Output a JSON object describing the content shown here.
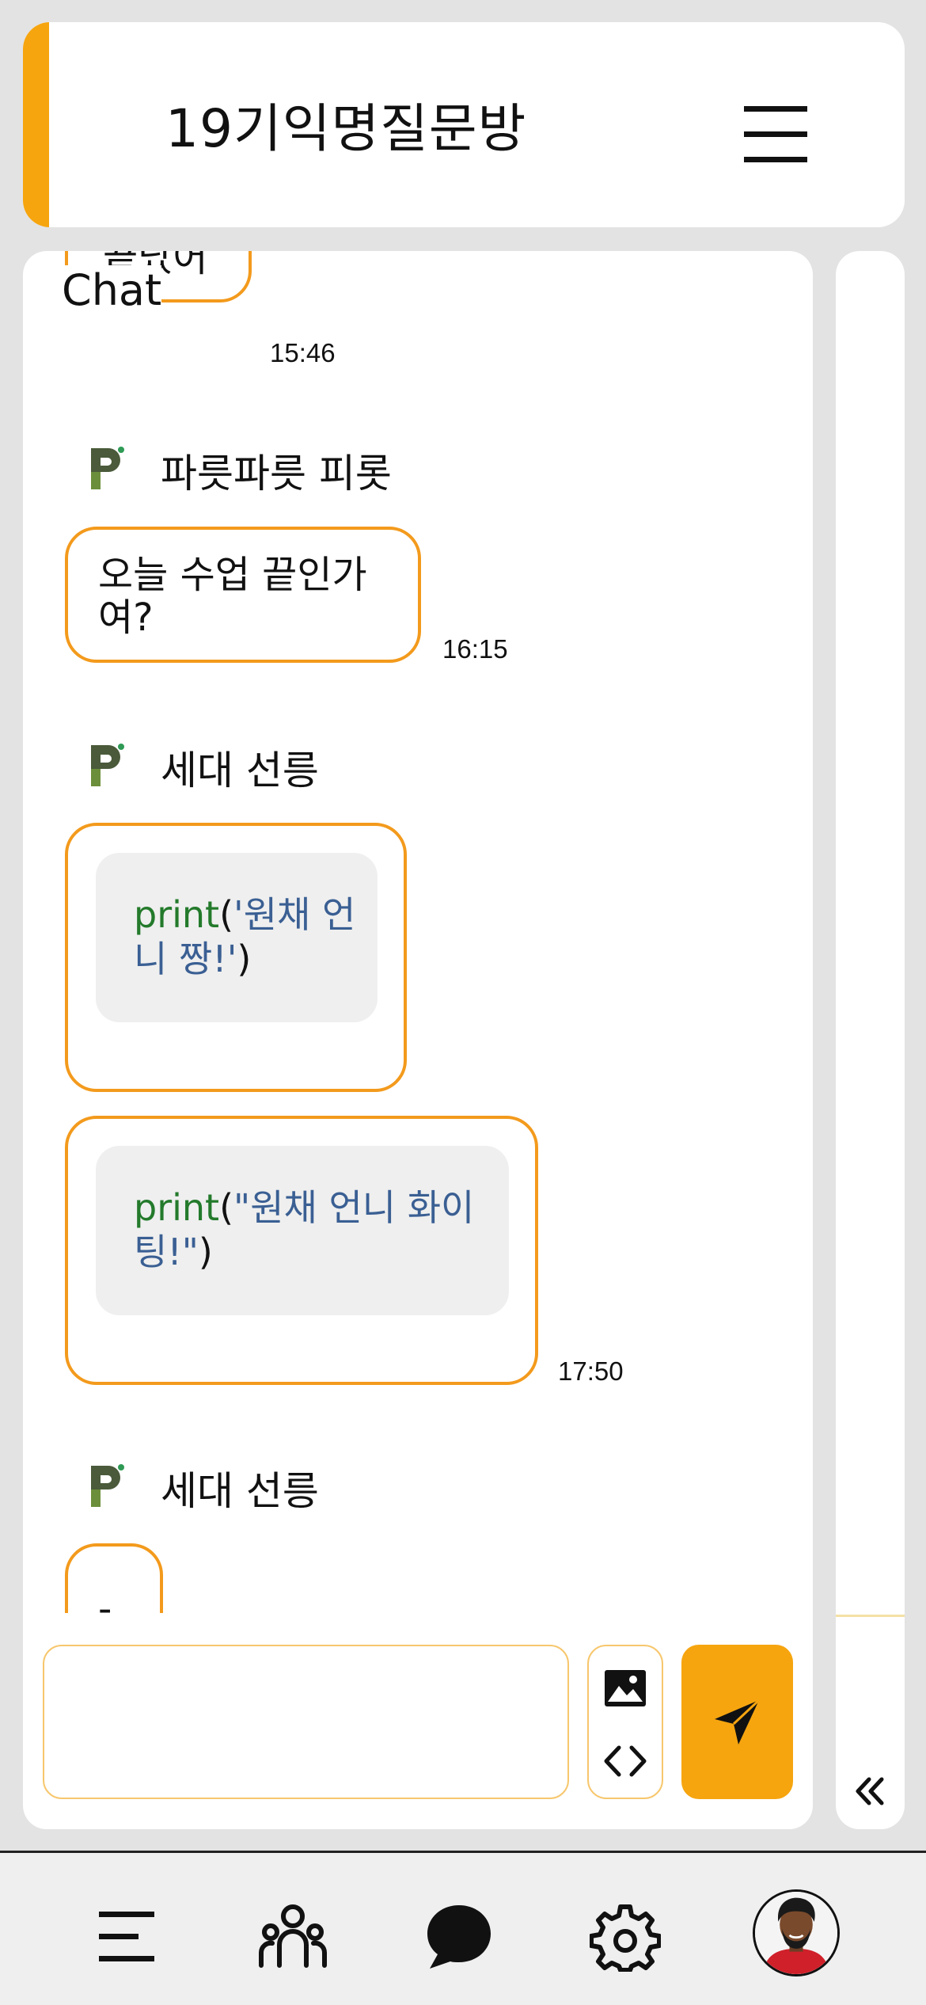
{
  "header": {
    "title": "19기익명질문방",
    "accent_color": "#f6a50f",
    "menu_icon": "hamburger-icon"
  },
  "chat": {
    "label": "Chat",
    "partial_top_bubble": {
      "text": "끝났어요?",
      "time": "15:46"
    },
    "groups": [
      {
        "sender": "파릇파릇 피롯",
        "messages": [
          {
            "type": "text",
            "text": "오늘 수업 끝인가여?"
          }
        ],
        "time": "16:15"
      },
      {
        "sender": "세대 선릉",
        "messages": [
          {
            "type": "code",
            "keyword": "print",
            "open": "(",
            "string": "'원채 언니 짱!'",
            "close": ")"
          },
          {
            "type": "code",
            "keyword": "print",
            "open": "(",
            "string": "\"원채 언니 화이팅!\"",
            "close": ")"
          }
        ],
        "time": "17:50"
      },
      {
        "sender": "세대 선릉",
        "messages": [
          {
            "type": "text",
            "text": "-"
          }
        ]
      }
    ]
  },
  "composer": {
    "placeholder": "",
    "image_icon": "image-icon",
    "code_icon": "code-icon",
    "send_icon": "send-icon",
    "send_color": "#f6a50f"
  },
  "side_panel": {
    "collapse_icon": "double-chevron-left-icon"
  },
  "bottom_nav": {
    "items": [
      "menu-icon",
      "users-icon",
      "chat-icon",
      "settings-icon",
      "profile-avatar"
    ]
  }
}
